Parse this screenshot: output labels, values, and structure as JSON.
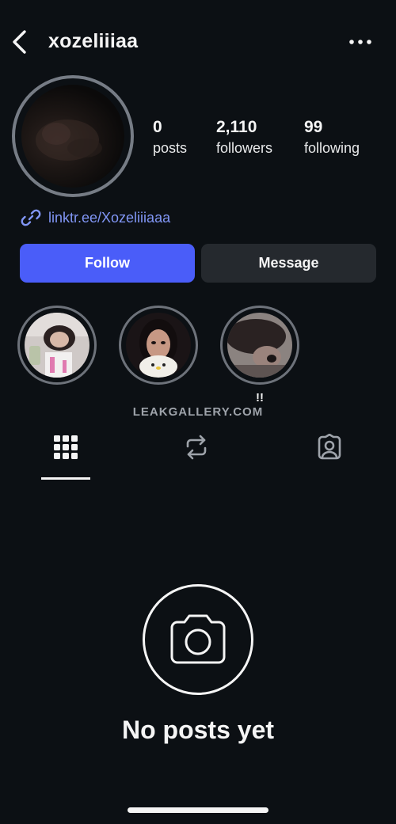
{
  "header": {
    "username": "xozeliiiaa"
  },
  "stats": [
    {
      "value": "0",
      "label": "posts"
    },
    {
      "value": "2,110",
      "label": "followers"
    },
    {
      "value": "99",
      "label": "following"
    }
  ],
  "bio": {
    "link_text": "linktr.ee/Xozeliiiaaa"
  },
  "actions": {
    "follow_label": "Follow",
    "message_label": "Message"
  },
  "highlights": [
    {
      "label": ""
    },
    {
      "label": ""
    },
    {
      "label": "!!"
    }
  ],
  "watermark": "LEAKGALLERY.COM",
  "tabs": [
    "posts-grid-icon",
    "reposts-icon",
    "tagged-icon"
  ],
  "empty_state": {
    "title": "No posts yet"
  },
  "colors": {
    "background": "#0c1014",
    "accent": "#4a5df9",
    "link": "#8196f5",
    "secondary_button": "#25292e"
  }
}
